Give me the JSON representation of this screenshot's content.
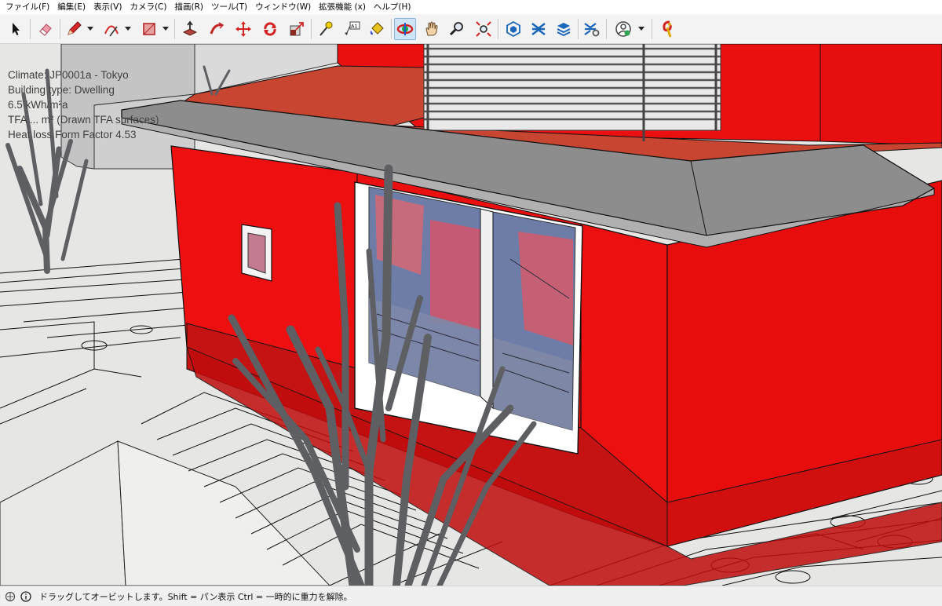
{
  "menu": {
    "items": [
      "ファイル(F)",
      "編集(E)",
      "表示(V)",
      "カメラ(C)",
      "描画(R)",
      "ツール(T)",
      "ウィンドウ(W)",
      "拡張機能 (x)",
      "ヘルプ(H)"
    ]
  },
  "toolbar": {
    "tools": [
      {
        "name": "select-icon"
      },
      {
        "name": "eraser-icon"
      },
      {
        "name": "pencil-icon"
      },
      {
        "name": "arc-icon"
      },
      {
        "name": "rectangle-icon"
      },
      {
        "name": "push-pull-icon"
      },
      {
        "name": "follow-me-icon"
      },
      {
        "name": "move-icon"
      },
      {
        "name": "rotate-icon"
      },
      {
        "name": "scale-icon"
      },
      {
        "name": "tape-measure-icon"
      },
      {
        "name": "text-icon"
      },
      {
        "name": "paint-bucket-icon"
      },
      {
        "name": "orbit-icon"
      },
      {
        "name": "pan-icon"
      },
      {
        "name": "zoom-icon"
      },
      {
        "name": "zoom-extents-icon"
      },
      {
        "name": "warehouse-icon"
      },
      {
        "name": "extension-warehouse-icon"
      },
      {
        "name": "layers-icon"
      },
      {
        "name": "extension-manager-icon"
      },
      {
        "name": "account-icon"
      },
      {
        "name": "ruby-plugin-icon"
      }
    ],
    "text_tool_label": "A1",
    "active_tool": "orbit"
  },
  "viewport": {
    "info": [
      "Climate: JP0001a - Tokyo",
      "Building type: Dwelling",
      "6.5 kWh/m²a",
      "TFA  ... m² (Drawn TFA surfaces)",
      "Heat loss Form Factor 4.53"
    ]
  },
  "colors": {
    "wall": "#ee1010",
    "wall_dark": "#d20a0a",
    "roof_upper": "#c84532",
    "soffit": "#8d8d8d",
    "ground": "#e6e6e4",
    "trunk": "#5e5f63",
    "glass": "#6d7da8",
    "accent": "#1a7dc4"
  },
  "statusbar": {
    "text": "ドラッグしてオービットします。Shift = パン表示   Ctrl = 一時的に重力を解除。"
  }
}
